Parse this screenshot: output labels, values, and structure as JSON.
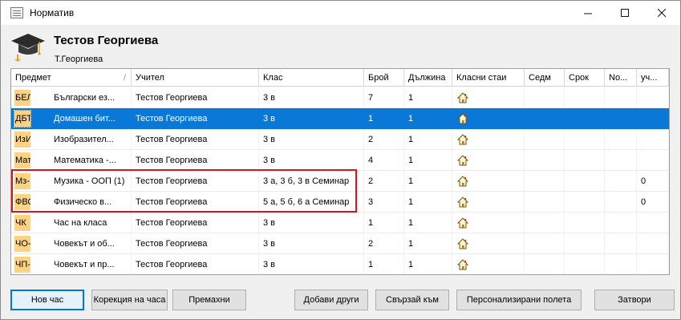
{
  "window": {
    "title": "Норматив",
    "minimize_icon": "minimize-icon",
    "maximize_icon": "maximize-icon",
    "close_icon": "close-icon"
  },
  "header": {
    "name": "Тестов Георгиева",
    "short_name": "Т.Георгиева",
    "icon": "graduation-cap-icon"
  },
  "columns": [
    "Предмет",
    "Учител",
    "Клас",
    "Брой",
    "Дължина",
    "Класни стаи",
    "Седм",
    "Срок",
    "No...",
    "уч..."
  ],
  "rows": [
    {
      "abbr": "БЕЛ",
      "subject": "Български ез...",
      "teacher": "Тестов Георгиева",
      "class": "3 в",
      "count": "7",
      "length": "1",
      "rooms_icon": "house-icon",
      "week": "",
      "term": "",
      "no": "",
      "uch": ""
    },
    {
      "abbr": "ДБТ",
      "subject": "Домашен бит...",
      "teacher": "Тестов Георгиева",
      "class": "3 в",
      "count": "1",
      "length": "1",
      "rooms_icon": "house-icon",
      "week": "",
      "term": "",
      "no": "",
      "uch": ""
    },
    {
      "abbr": "ИзИ",
      "subject": "Изобразител...",
      "teacher": "Тестов Георгиева",
      "class": "3 в",
      "count": "2",
      "length": "1",
      "rooms_icon": "house-icon",
      "week": "",
      "term": "",
      "no": "",
      "uch": ""
    },
    {
      "abbr": "Мат",
      "subject": "Математика -...",
      "teacher": "Тестов Георгиева",
      "class": "3 в",
      "count": "4",
      "length": "1",
      "rooms_icon": "house-icon",
      "week": "",
      "term": "",
      "no": "",
      "uch": ""
    },
    {
      "abbr": "Мз-",
      "subject": "Музика - ООП (1)",
      "teacher": "Тестов Георгиева",
      "class": "3 а, 3 б, 3 в Семинар",
      "count": "2",
      "length": "1",
      "rooms_icon": "house-icon",
      "week": "",
      "term": "",
      "no": "",
      "uch": "0"
    },
    {
      "abbr": "ФВС",
      "subject": "Физическо в...",
      "teacher": "Тестов Георгиева",
      "class": "5 а, 5 б, 6 а Семинар",
      "count": "3",
      "length": "1",
      "rooms_icon": "house-icon",
      "week": "",
      "term": "",
      "no": "",
      "uch": "0"
    },
    {
      "abbr": "ЧК",
      "subject": "Час на класа",
      "teacher": "Тестов Георгиева",
      "class": "3 в",
      "count": "1",
      "length": "1",
      "rooms_icon": "house-icon",
      "week": "",
      "term": "",
      "no": "",
      "uch": ""
    },
    {
      "abbr": "ЧО-",
      "subject": "Човекът и об...",
      "teacher": "Тестов Георгиева",
      "class": "3 в",
      "count": "2",
      "length": "1",
      "rooms_icon": "house-icon",
      "week": "",
      "term": "",
      "no": "",
      "uch": ""
    },
    {
      "abbr": "ЧП-",
      "subject": "Човекът и пр...",
      "teacher": "Тестов Георгиева",
      "class": "3 в",
      "count": "1",
      "length": "1",
      "rooms_icon": "house-icon",
      "week": "",
      "term": "",
      "no": "",
      "uch": ""
    }
  ],
  "selected_row_index": 1,
  "buttons": {
    "new": "Нов час",
    "correct": "Корекция на часа",
    "remove": "Премахни",
    "add_other": "Добави други",
    "join": "Свързай към",
    "custom_fields": "Персонализирани полета",
    "close": "Затвори"
  },
  "colors": {
    "selection": "#0a78d7",
    "abbr_bg": "#fbd383",
    "highlight": "#d9141e",
    "primary_border": "#0078d7"
  }
}
